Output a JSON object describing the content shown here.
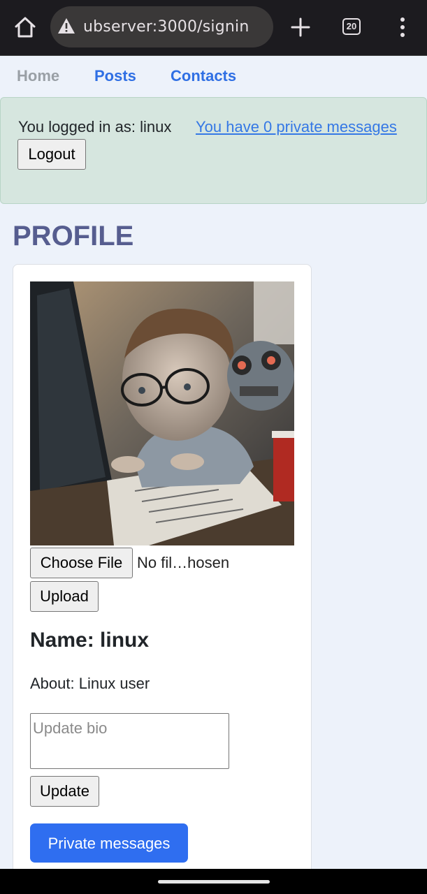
{
  "browser": {
    "url": "ubserver:3000/signin",
    "tab_count": "20",
    "icons": {
      "home": "home-icon",
      "warning": "warning-triangle-icon",
      "new_tab": "plus-icon",
      "tabs": "tab-switcher-icon",
      "menu": "more-vert-icon"
    },
    "chrome_color": "#1c1b1f"
  },
  "nav": {
    "home": "Home",
    "posts": "Posts",
    "contacts": "Contacts",
    "link_color": "#2f6fe4"
  },
  "session": {
    "logged_in_text": "You logged in as: linux",
    "messages_link": "You have 0 private messages",
    "logout_label": "Logout",
    "panel_color": "#d6e6df"
  },
  "profile": {
    "page_title": "PROFILE",
    "choose_file_label": "Choose File",
    "file_status": "No fil…hosen",
    "upload_label": "Upload",
    "name_heading": "Name: linux",
    "about_text": "About: Linux user",
    "bio_placeholder": "Update bio",
    "update_label": "Update",
    "private_messages_label": "Private messages",
    "accent_color": "#2f6ef0"
  }
}
